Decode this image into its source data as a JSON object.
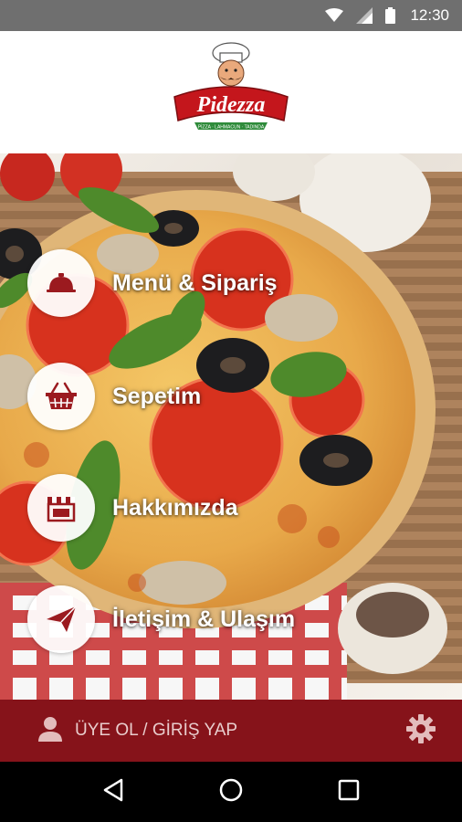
{
  "status_bar": {
    "time": "12:30",
    "icons": [
      "wifi-icon",
      "signal-icon",
      "battery-icon"
    ]
  },
  "header": {
    "logo_text": "Pidezza",
    "logo_tagline": "PİZZA · LAHMACUN · TADINDA"
  },
  "menu": {
    "items": [
      {
        "label": "Menü & Sipariş",
        "icon": "cloche-icon"
      },
      {
        "label": "Sepetim",
        "icon": "basket-icon"
      },
      {
        "label": "Hakkımızda",
        "icon": "store-icon"
      },
      {
        "label": "İletişim & Ulaşım",
        "icon": "paper-plane-icon"
      }
    ]
  },
  "user_bar": {
    "login_label": "ÜYE OL / GİRİŞ YAP",
    "icons": [
      "user-icon",
      "gear-icon"
    ]
  },
  "nav_bar": {
    "icons": [
      "back-icon",
      "home-icon",
      "recents-icon"
    ]
  },
  "colors": {
    "brand_red": "#86131a",
    "status_bar": "#6f6f6f",
    "logo_red": "#c4161c",
    "logo_green": "#2e8b3a"
  }
}
